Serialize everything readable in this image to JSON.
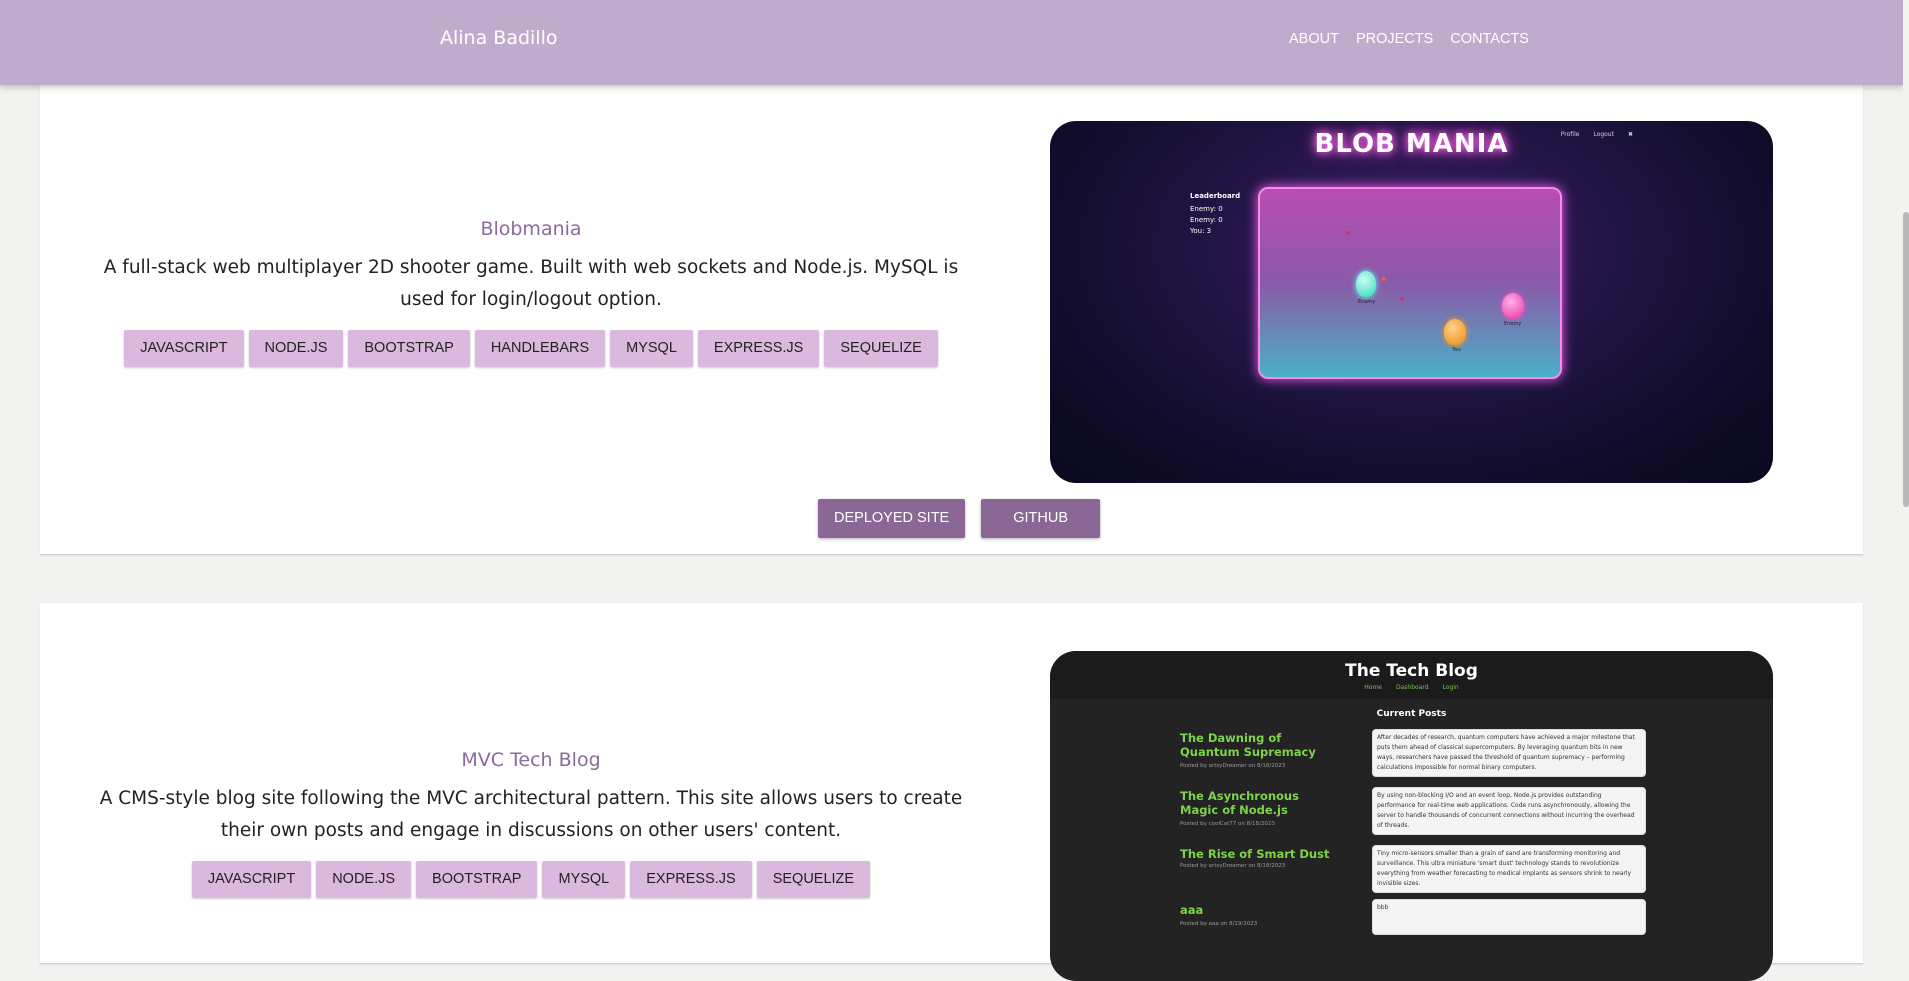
{
  "header": {
    "brand": "Alina Badillo",
    "nav": [
      "ABOUT",
      "PROJECTS",
      "CONTACTS"
    ]
  },
  "colors": {
    "navbar": "#bfaccd",
    "tag": "#dbb8dd",
    "button": "#8a6795",
    "title": "#8c6a9b"
  },
  "projects": [
    {
      "title": "Blobmania",
      "description": "A full-stack web multiplayer 2D shooter game. Built with web sockets and Node.js. MySQL is used for login/logout option.",
      "tags": [
        "JAVASCRIPT",
        "NODE.JS",
        "BOOTSTRAP",
        "HANDLEBARS",
        "MYSQL",
        "EXPRESS.JS",
        "SEQUELIZE"
      ],
      "deployed_label": "DEPLOYED SITE",
      "github_label": "GITHUB",
      "screenshot": {
        "title": "BLOB MANIA",
        "nav": [
          "Profile",
          "Logout",
          "✖"
        ],
        "leaderboard_title": "Leaderboard",
        "leaderboard": [
          "Enemy: 0",
          "Enemy: 0",
          "You: 3"
        ],
        "players": [
          "Enemy",
          "You",
          "Enemy"
        ]
      }
    },
    {
      "title": "MVC Tech Blog",
      "description": "A CMS-style blog site following the MVC architectural pattern. This site allows users to create their own posts and engage in discussions on other users' content.",
      "tags": [
        "JAVASCRIPT",
        "NODE.JS",
        "BOOTSTRAP",
        "MYSQL",
        "EXPRESS.JS",
        "SEQUELIZE"
      ],
      "screenshot": {
        "title": "The Tech Blog",
        "nav": [
          "Home",
          "Dashboard",
          "Login"
        ],
        "current_posts": "Current Posts",
        "posts": [
          {
            "title": "The Dawning of Quantum Supremacy",
            "meta": "Posted by artsyDreamer on 8/18/2023",
            "body": "After decades of research, quantum computers have achieved a major milestone that puts them ahead of classical supercomputers. By leveraging quantum bits in new ways, researchers have passed the threshold of quantum supremacy – performing calculations impossible for normal binary computers."
          },
          {
            "title": "The Asynchronous Magic of Node.js",
            "meta": "Posted by coolCat77 on 8/18/2023",
            "body": "By using non-blocking I/O and an event loop, Node.js provides outstanding performance for real-time web applications. Code runs asynchronously, allowing the server to handle thousands of concurrent connections without incurring the overhead of threads."
          },
          {
            "title": "The Rise of Smart Dust",
            "meta": "Posted by artsyDreamer on 8/18/2023",
            "body": "Tiny micro-sensors smaller than a grain of sand are transforming monitoring and surveillance. This ultra miniature 'smart dust' technology stands to revolutionize everything from weather forecasting to medical implants as sensors shrink to nearly invisible sizes."
          },
          {
            "title": "aaa",
            "meta": "Posted by aaa on 8/19/2023",
            "body": "bbb"
          }
        ]
      }
    }
  ]
}
